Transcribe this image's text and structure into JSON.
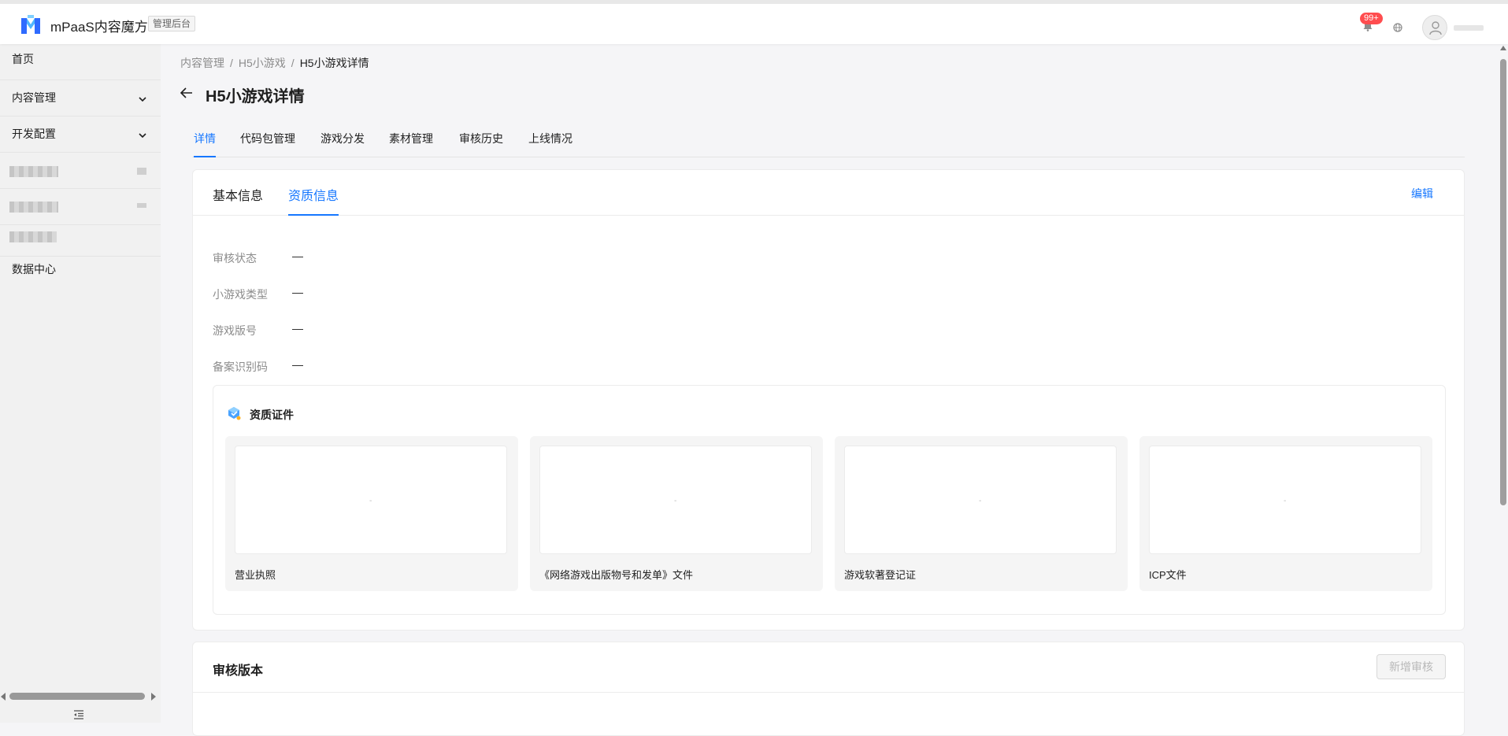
{
  "header": {
    "brand": "mPaaS内容魔方",
    "tag": "管理后台",
    "notification_badge": "99+"
  },
  "sidebar": {
    "items": [
      {
        "label": "首页"
      },
      {
        "label": "内容管理"
      },
      {
        "label": "开发配置"
      },
      {
        "label": "数据中心"
      }
    ]
  },
  "breadcrumb": [
    "内容管理",
    "H5小游戏",
    "H5小游戏详情"
  ],
  "breadcrumb_sep": "/",
  "page": {
    "title": "H5小游戏详情"
  },
  "tabs": [
    "详情",
    "代码包管理",
    "游戏分发",
    "素材管理",
    "审核历史",
    "上线情况"
  ],
  "card": {
    "tabs": [
      "基本信息",
      "资质信息"
    ],
    "edit": "编辑",
    "fields": [
      {
        "label": "审核状态",
        "value": "—"
      },
      {
        "label": "小游戏类型",
        "value": "—"
      },
      {
        "label": "游戏版号",
        "value": "—"
      },
      {
        "label": "备案识别码",
        "value": "—"
      }
    ],
    "qualification": {
      "title": "资质证件",
      "placeholder": "-",
      "items": [
        "营业执照",
        "《网络游戏出版物号和发单》文件",
        "游戏软著登记证",
        "ICP文件"
      ]
    }
  },
  "review": {
    "title": "审核版本",
    "add_button": "新增审核"
  }
}
